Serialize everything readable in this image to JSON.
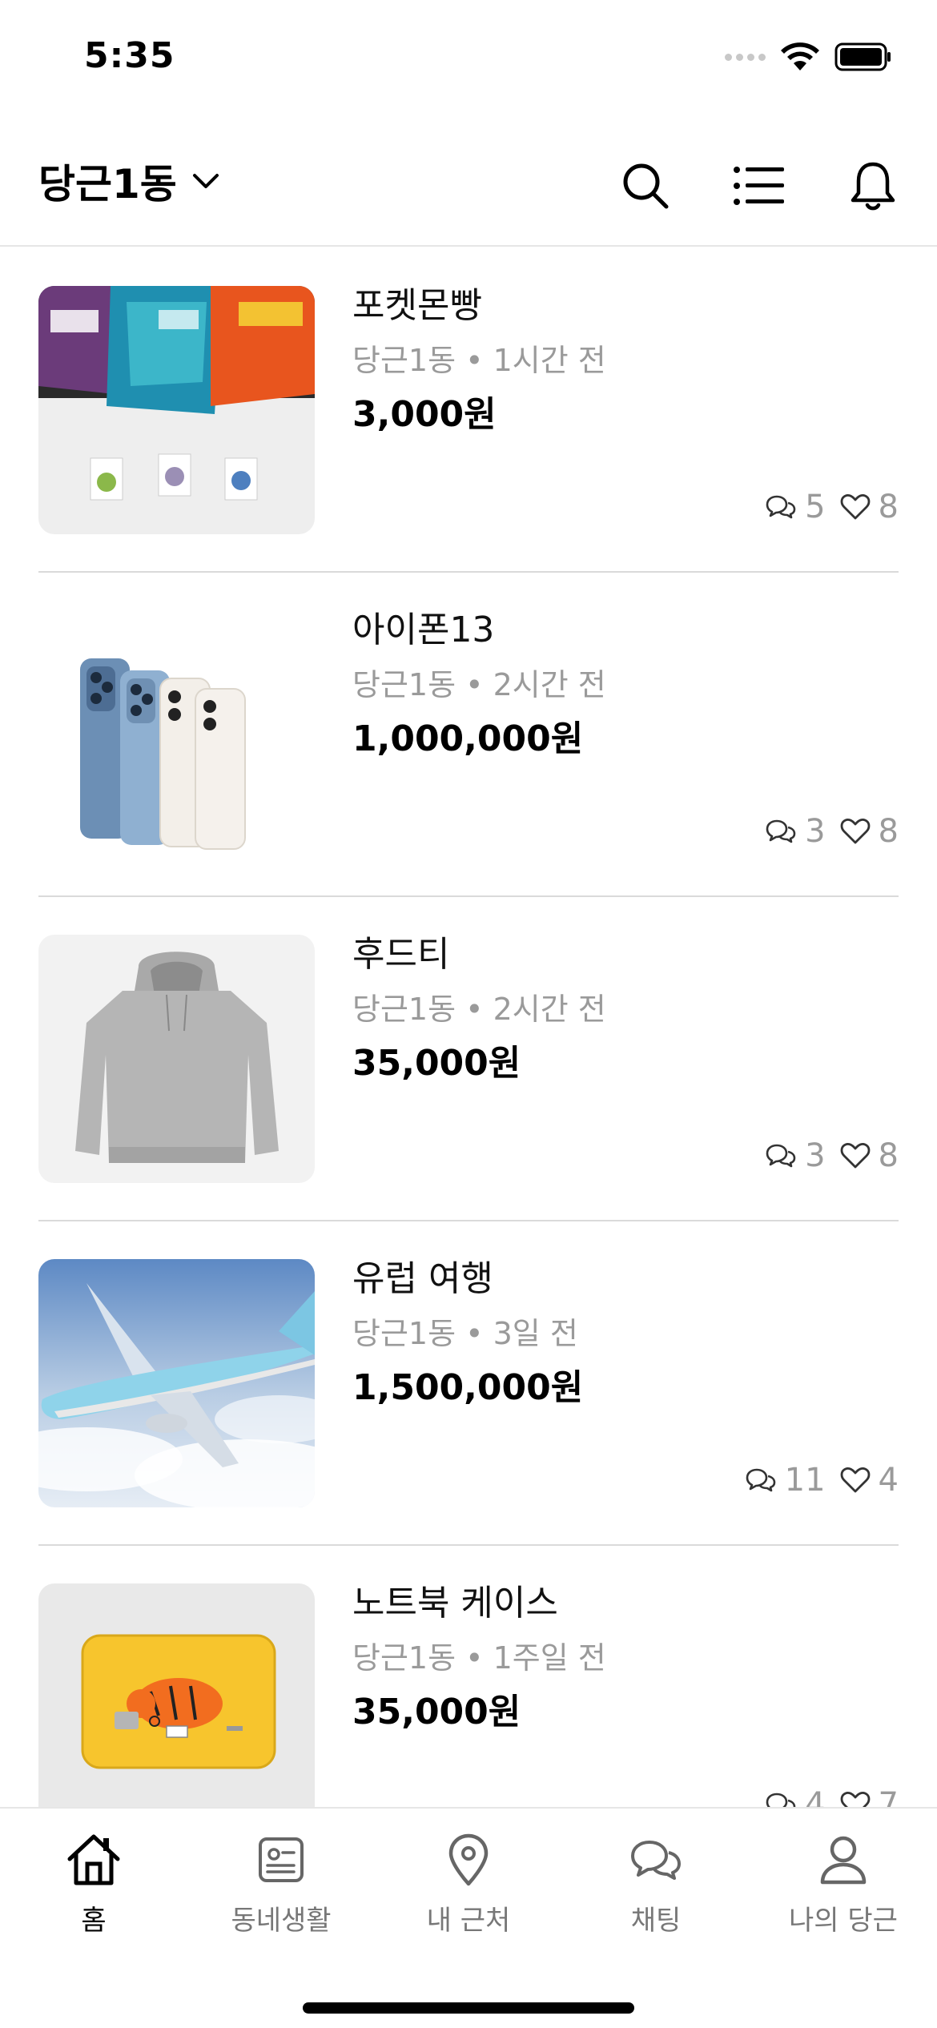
{
  "status_bar": {
    "time": "5:35"
  },
  "header": {
    "location": "당근1동"
  },
  "items": [
    {
      "title": "포켓몬빵",
      "meta": "당근1동 • 1시간 전",
      "price": "3,000원",
      "comments": "5",
      "likes": "8"
    },
    {
      "title": "아이폰13",
      "meta": "당근1동 • 2시간 전",
      "price": "1,000,000원",
      "comments": "3",
      "likes": "8"
    },
    {
      "title": "후드티",
      "meta": "당근1동 • 2시간 전",
      "price": "35,000원",
      "comments": "3",
      "likes": "8"
    },
    {
      "title": "유럽 여행",
      "meta": "당근1동 • 3일 전",
      "price": "1,500,000원",
      "comments": "11",
      "likes": "4"
    },
    {
      "title": "노트북 케이스",
      "meta": "당근1동 • 1주일 전",
      "price": "35,000원",
      "comments": "4",
      "likes": "7"
    }
  ],
  "tabs": [
    {
      "label": "홈",
      "icon": "home-icon",
      "active": true
    },
    {
      "label": "동네생활",
      "icon": "neighborhood-icon",
      "active": false
    },
    {
      "label": "내 근처",
      "icon": "location-pin-icon",
      "active": false
    },
    {
      "label": "채팅",
      "icon": "chat-icon",
      "active": false
    },
    {
      "label": "나의 당근",
      "icon": "person-icon",
      "active": false
    }
  ],
  "colors": {
    "meta_gray": "#9a9a9a",
    "divider": "#dadada"
  }
}
